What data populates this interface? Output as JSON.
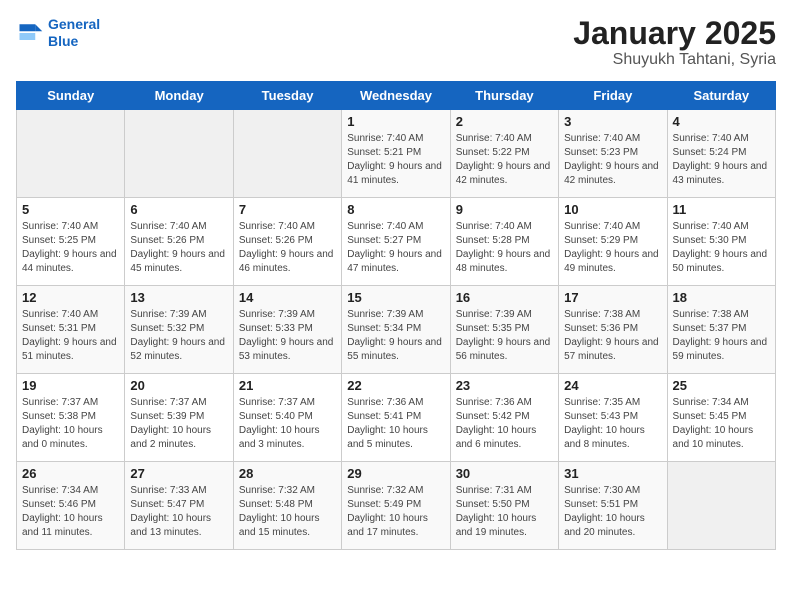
{
  "header": {
    "logo_line1": "General",
    "logo_line2": "Blue",
    "title": "January 2025",
    "subtitle": "Shuyukh Tahtani, Syria"
  },
  "days_of_week": [
    "Sunday",
    "Monday",
    "Tuesday",
    "Wednesday",
    "Thursday",
    "Friday",
    "Saturday"
  ],
  "weeks": [
    [
      {
        "day": "",
        "info": ""
      },
      {
        "day": "",
        "info": ""
      },
      {
        "day": "",
        "info": ""
      },
      {
        "day": "1",
        "info": "Sunrise: 7:40 AM\nSunset: 5:21 PM\nDaylight: 9 hours and 41 minutes."
      },
      {
        "day": "2",
        "info": "Sunrise: 7:40 AM\nSunset: 5:22 PM\nDaylight: 9 hours and 42 minutes."
      },
      {
        "day": "3",
        "info": "Sunrise: 7:40 AM\nSunset: 5:23 PM\nDaylight: 9 hours and 42 minutes."
      },
      {
        "day": "4",
        "info": "Sunrise: 7:40 AM\nSunset: 5:24 PM\nDaylight: 9 hours and 43 minutes."
      }
    ],
    [
      {
        "day": "5",
        "info": "Sunrise: 7:40 AM\nSunset: 5:25 PM\nDaylight: 9 hours and 44 minutes."
      },
      {
        "day": "6",
        "info": "Sunrise: 7:40 AM\nSunset: 5:26 PM\nDaylight: 9 hours and 45 minutes."
      },
      {
        "day": "7",
        "info": "Sunrise: 7:40 AM\nSunset: 5:26 PM\nDaylight: 9 hours and 46 minutes."
      },
      {
        "day": "8",
        "info": "Sunrise: 7:40 AM\nSunset: 5:27 PM\nDaylight: 9 hours and 47 minutes."
      },
      {
        "day": "9",
        "info": "Sunrise: 7:40 AM\nSunset: 5:28 PM\nDaylight: 9 hours and 48 minutes."
      },
      {
        "day": "10",
        "info": "Sunrise: 7:40 AM\nSunset: 5:29 PM\nDaylight: 9 hours and 49 minutes."
      },
      {
        "day": "11",
        "info": "Sunrise: 7:40 AM\nSunset: 5:30 PM\nDaylight: 9 hours and 50 minutes."
      }
    ],
    [
      {
        "day": "12",
        "info": "Sunrise: 7:40 AM\nSunset: 5:31 PM\nDaylight: 9 hours and 51 minutes."
      },
      {
        "day": "13",
        "info": "Sunrise: 7:39 AM\nSunset: 5:32 PM\nDaylight: 9 hours and 52 minutes."
      },
      {
        "day": "14",
        "info": "Sunrise: 7:39 AM\nSunset: 5:33 PM\nDaylight: 9 hours and 53 minutes."
      },
      {
        "day": "15",
        "info": "Sunrise: 7:39 AM\nSunset: 5:34 PM\nDaylight: 9 hours and 55 minutes."
      },
      {
        "day": "16",
        "info": "Sunrise: 7:39 AM\nSunset: 5:35 PM\nDaylight: 9 hours and 56 minutes."
      },
      {
        "day": "17",
        "info": "Sunrise: 7:38 AM\nSunset: 5:36 PM\nDaylight: 9 hours and 57 minutes."
      },
      {
        "day": "18",
        "info": "Sunrise: 7:38 AM\nSunset: 5:37 PM\nDaylight: 9 hours and 59 minutes."
      }
    ],
    [
      {
        "day": "19",
        "info": "Sunrise: 7:37 AM\nSunset: 5:38 PM\nDaylight: 10 hours and 0 minutes."
      },
      {
        "day": "20",
        "info": "Sunrise: 7:37 AM\nSunset: 5:39 PM\nDaylight: 10 hours and 2 minutes."
      },
      {
        "day": "21",
        "info": "Sunrise: 7:37 AM\nSunset: 5:40 PM\nDaylight: 10 hours and 3 minutes."
      },
      {
        "day": "22",
        "info": "Sunrise: 7:36 AM\nSunset: 5:41 PM\nDaylight: 10 hours and 5 minutes."
      },
      {
        "day": "23",
        "info": "Sunrise: 7:36 AM\nSunset: 5:42 PM\nDaylight: 10 hours and 6 minutes."
      },
      {
        "day": "24",
        "info": "Sunrise: 7:35 AM\nSunset: 5:43 PM\nDaylight: 10 hours and 8 minutes."
      },
      {
        "day": "25",
        "info": "Sunrise: 7:34 AM\nSunset: 5:45 PM\nDaylight: 10 hours and 10 minutes."
      }
    ],
    [
      {
        "day": "26",
        "info": "Sunrise: 7:34 AM\nSunset: 5:46 PM\nDaylight: 10 hours and 11 minutes."
      },
      {
        "day": "27",
        "info": "Sunrise: 7:33 AM\nSunset: 5:47 PM\nDaylight: 10 hours and 13 minutes."
      },
      {
        "day": "28",
        "info": "Sunrise: 7:32 AM\nSunset: 5:48 PM\nDaylight: 10 hours and 15 minutes."
      },
      {
        "day": "29",
        "info": "Sunrise: 7:32 AM\nSunset: 5:49 PM\nDaylight: 10 hours and 17 minutes."
      },
      {
        "day": "30",
        "info": "Sunrise: 7:31 AM\nSunset: 5:50 PM\nDaylight: 10 hours and 19 minutes."
      },
      {
        "day": "31",
        "info": "Sunrise: 7:30 AM\nSunset: 5:51 PM\nDaylight: 10 hours and 20 minutes."
      },
      {
        "day": "",
        "info": ""
      }
    ]
  ]
}
